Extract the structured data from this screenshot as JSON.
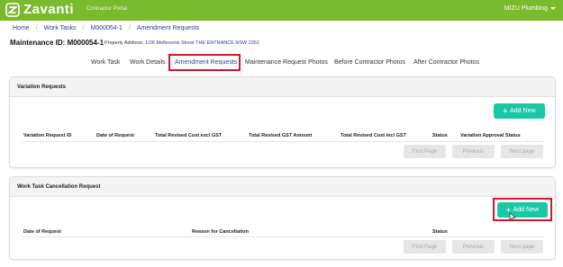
{
  "header": {
    "brand": "Zavanti",
    "portal_label": "Contractor Portal",
    "company": "MIZU Plumbing",
    "brand_color": "#79bb2d"
  },
  "breadcrumb": [
    "Home",
    "Work Tasks",
    "M000054-1",
    "Amendment Requests"
  ],
  "maintenance": {
    "id_label": "Maintenance ID: M000054-1",
    "address_label": "Property Address:",
    "address_value": "1/26 Melbourne Street THE ENTRANCE NSW 2261"
  },
  "tabs": [
    "Work Task",
    "Work Details",
    "Amendment Requests",
    "Maintenance Request Photos",
    "Before Contractor Photos",
    "After Contractor Photos"
  ],
  "active_tab": "Amendment Requests",
  "variation_requests": {
    "title": "Variation Requests",
    "add_label": "Add New",
    "columns": [
      "Variation Request ID",
      "Date of Request",
      "Total Revised Cost excl GST",
      "Total Revised GST Amount",
      "Total Revised Cost incl GST",
      "Status",
      "Variation Approval Status"
    ],
    "pagination": [
      "First Page",
      "Previous",
      "Next page"
    ]
  },
  "cancellation_requests": {
    "title": "Work Task Cancellation Request",
    "add_label": "Add New",
    "columns": [
      "Date of Request",
      "Reason for Cancellation",
      "Status"
    ],
    "pagination": [
      "First Page",
      "Previous",
      "Next page"
    ]
  },
  "accent_color": "#19c9a6",
  "highlight_color": "#d8142a"
}
